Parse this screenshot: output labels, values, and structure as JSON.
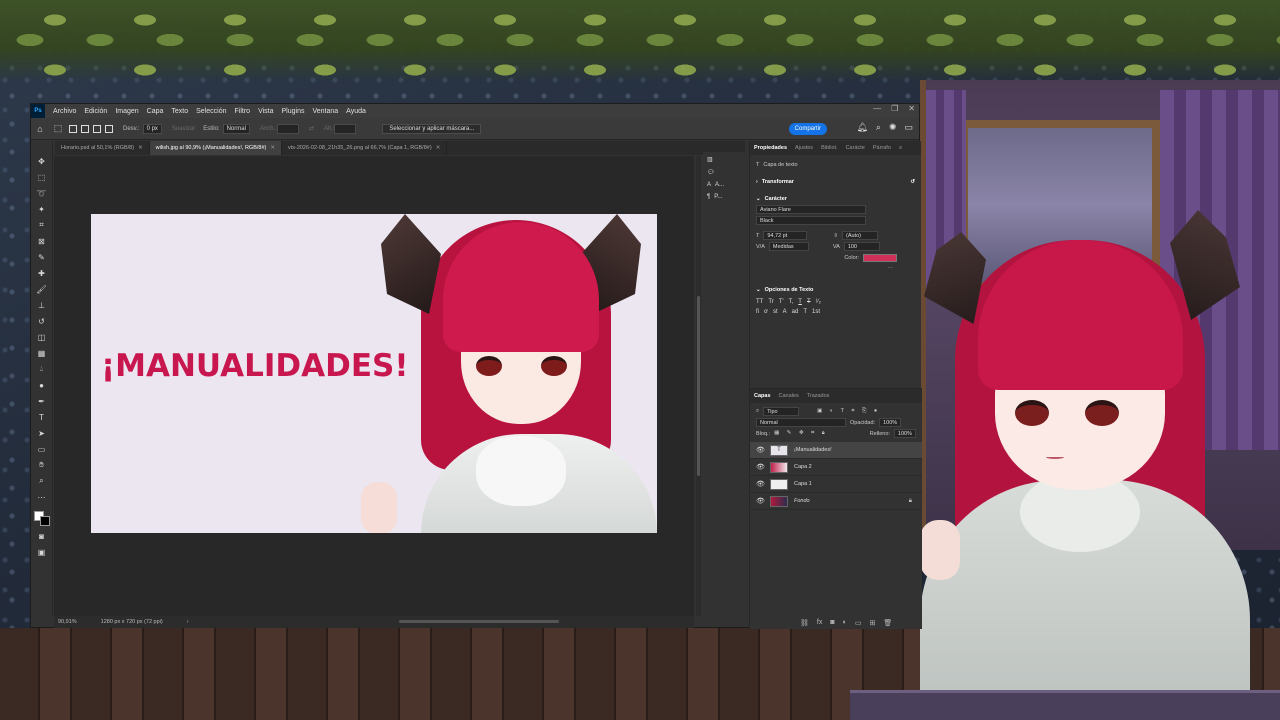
{
  "menubar": {
    "app_logo": "Ps",
    "items": [
      "Archivo",
      "Edición",
      "Imagen",
      "Capa",
      "Texto",
      "Selección",
      "Filtro",
      "Vista",
      "Plugins",
      "Ventana",
      "Ayuda"
    ]
  },
  "options_bar": {
    "desv_label": "Desv.:",
    "desv_value": "0 px",
    "suavizar_label": "Suavizar",
    "estilo_label": "Estilo:",
    "estilo_value": "Normal",
    "anch_label": "Anch.:",
    "alt_label": "Alt.:",
    "mask_button": "Seleccionar y aplicar máscara...",
    "share_button": "Compartir"
  },
  "tabs": [
    {
      "label": "Horario.psd al 50,1% (RGB/8)",
      "active": false
    },
    {
      "label": "wilish.jpg al 90,9% (¡Manualidades!, RGB/8#)",
      "active": true
    },
    {
      "label": "vts-2026-02-08_21h35_26.png al 66,7% (Capa 1, RGB/8#)",
      "active": false
    }
  ],
  "canvas": {
    "title_text": "¡MANUALIDADES!",
    "title_color": "#c8174e"
  },
  "statusbar": {
    "zoom": "90,91%",
    "doc_info": "1280 px x 720 px (72 ppi)"
  },
  "mini_panel": [
    "A...",
    "P..."
  ],
  "properties": {
    "tabs": [
      "Propiedades",
      "Ajustes",
      "Bibliot.",
      "Carácte",
      "Párrafo"
    ],
    "layer_kind": "Capa de texto",
    "transform_section": "Transformar",
    "character_section": "Carácter",
    "font_family": "Aviano Flare",
    "font_style": "Black",
    "font_size": "94,72 pt",
    "leading": "(Auto)",
    "kerning": "Medidas",
    "tracking": "100",
    "color_label": "Color:",
    "text_color": "#d0305a",
    "text_options_section": "Opciones de Texto",
    "glyphs_row1": [
      "TT",
      "Tr",
      "T'",
      "T,",
      "T",
      "T",
      "¹⁄₂"
    ],
    "glyphs_row2": [
      "fi",
      "ơ",
      "st",
      "A",
      "ad",
      "T",
      "1st"
    ]
  },
  "layers_panel": {
    "tabs": [
      "Capas",
      "Canales",
      "Trazados"
    ],
    "filter_label": "Tipo",
    "blend_mode": "Normal",
    "opacity_label": "Opacidad:",
    "opacity_value": "100%",
    "lock_label": "Bloq.:",
    "fill_label": "Relleno:",
    "fill_value": "100%",
    "layers": [
      {
        "name": "¡Manualidades!",
        "kind": "text",
        "selected": true,
        "locked": false
      },
      {
        "name": "Capa 2",
        "kind": "image",
        "selected": false,
        "locked": false
      },
      {
        "name": "Capa 1",
        "kind": "white",
        "selected": false,
        "locked": false
      },
      {
        "name": "Fondo",
        "kind": "art",
        "selected": false,
        "locked": true
      }
    ]
  }
}
